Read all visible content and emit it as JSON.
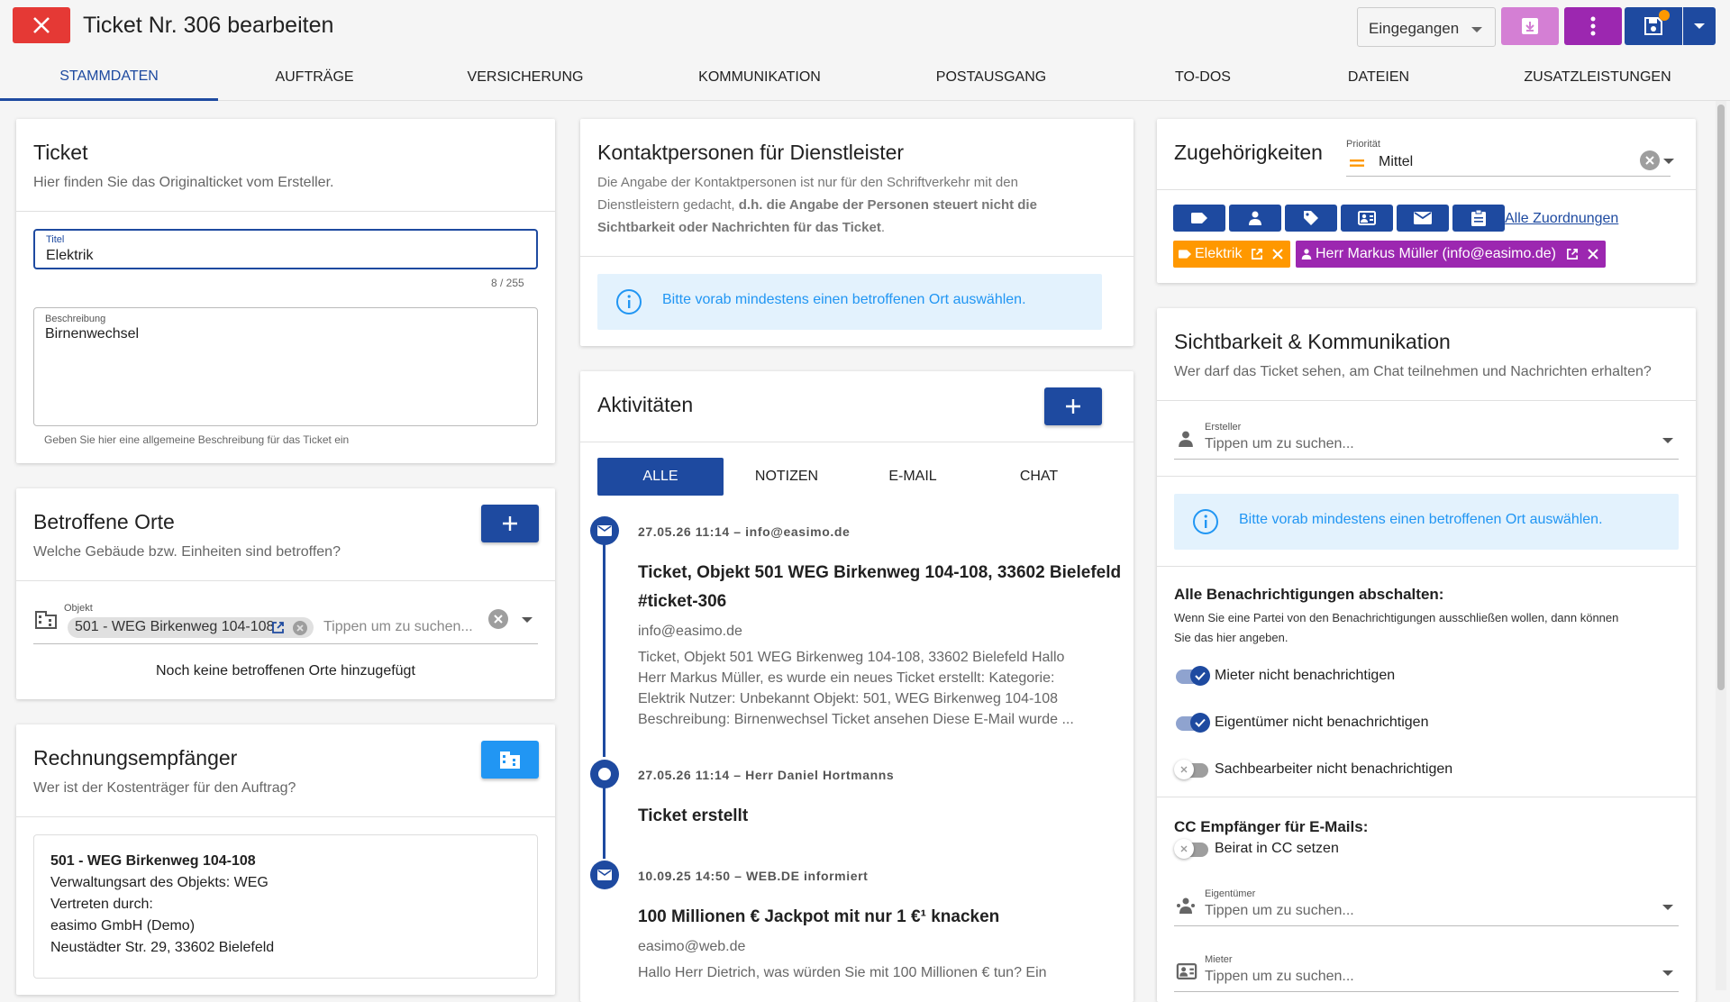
{
  "header": {
    "title": "Ticket Nr. 306 bearbeiten",
    "status_value": "Eingegangen",
    "colors": {
      "close": "#e53935",
      "download": "#d47fd4",
      "menu": "#9c27b0",
      "save": "#1e4aa0"
    }
  },
  "tabs": [
    {
      "label": "STAMMDATEN",
      "active": true
    },
    {
      "label": "AUFTRÄGE"
    },
    {
      "label": "VERSICHERUNG"
    },
    {
      "label": "KOMMUNIKATION"
    },
    {
      "label": "POSTAUSGANG"
    },
    {
      "label": "TO-DOS"
    },
    {
      "label": "DATEIEN"
    },
    {
      "label": "ZUSATZLEISTUNGEN"
    }
  ],
  "ticket": {
    "title": "Ticket",
    "subtitle": "Hier finden Sie das Originalticket vom Ersteller.",
    "titel_label": "Titel",
    "titel_value": "Elektrik",
    "counter": "8 / 255",
    "beschreibung_label": "Beschreibung",
    "beschreibung_value": "Birnenwechsel",
    "beschreibung_hint": "Geben Sie hier eine allgemeine Beschreibung für das Ticket ein"
  },
  "orte": {
    "title": "Betroffene Orte",
    "subtitle": "Welche Gebäude bzw. Einheiten sind betroffen?",
    "objekt_label": "Objekt",
    "objekt_chip": "501 - WEG Birkenweg 104-108",
    "placeholder": "Tippen um zu suchen...",
    "empty_text": "Noch keine betroffenen Orte hinzugefügt"
  },
  "rechnung": {
    "title": "Rechnungsempfänger",
    "subtitle": "Wer ist der Kostenträger für den Auftrag?",
    "lines": [
      "501 - WEG Birkenweg 104-108",
      "Verwaltungsart des Objekts: WEG",
      "Vertreten durch:",
      "easimo GmbH (Demo)",
      "Neustädter Str. 29, 33602 Bielefeld"
    ]
  },
  "kontakt": {
    "title": "Kontaktpersonen für Dienstleister",
    "desc_1": "Die Angabe der Kontaktpersonen ist nur für den Schriftverkehr mit den",
    "desc_2a": "Dienstleistern gedacht, ",
    "desc_2b": "d.h. die Angabe der Personen steuert nicht die",
    "desc_3b": "Sichtbarkeit oder Nachrichten für das Ticket",
    "desc_3c": ".",
    "info": "Bitte vorab mindestens einen betroffenen Ort auswählen."
  },
  "aktivitaeten": {
    "title": "Aktivitäten",
    "filters": [
      {
        "label": "ALLE",
        "active": true
      },
      {
        "label": "NOTIZEN"
      },
      {
        "label": "E-MAIL"
      },
      {
        "label": "CHAT"
      }
    ],
    "items": [
      {
        "meta": "27.05.26 11:14 – info@easimo.de",
        "title_1": "Ticket, Objekt 501 WEG Birkenweg 104-108, 33602 Bielefeld",
        "title_2": "#ticket-306",
        "from": "info@easimo.de",
        "body": [
          "Ticket, Objekt 501 WEG Birkenweg 104-108, 33602 Bielefeld Hallo",
          "Herr Markus Müller, es wurde ein neues Ticket erstellt: Kategorie:",
          "Elektrik Nutzer: Unbekannt Objekt: 501, WEG Birkenweg 104-108",
          "Beschreibung: Birnenwechsel Ticket ansehen Diese E-Mail wurde ..."
        ]
      },
      {
        "meta": "27.05.26 11:14 – Herr Daniel Hortmanns",
        "title_1": "Ticket erstellt"
      },
      {
        "meta": "10.09.25 14:50 – WEB.DE informiert",
        "title_1": "100 Millionen € Jackpot mit nur 1 €¹ knacken",
        "from": "easimo@web.de",
        "body": [
          "Hallo Herr Dietrich, was würden Sie mit 100 Millionen € tun? Ein"
        ]
      }
    ]
  },
  "zugehoerigkeiten": {
    "title": "Zugehörigkeiten",
    "prio_label": "Priorität",
    "prio_value": "Mittel",
    "alle_link": "Alle Zuordnungen",
    "tags": [
      {
        "label": "Elektrik",
        "color": "#ff9800"
      },
      {
        "label": "Herr Markus Müller (info@easimo.de)",
        "color": "#9c27b0"
      }
    ]
  },
  "sichtbarkeit": {
    "title": "Sichtbarkeit & Kommunikation",
    "subtitle": "Wer darf das Ticket sehen, am Chat teilnehmen und Nachrichten erhalten?",
    "ersteller_label": "Ersteller",
    "placeholder": "Tippen um zu suchen...",
    "info": "Bitte vorab mindestens einen betroffenen Ort auswählen.",
    "notify_title": "Alle Benachrichtigungen abschalten:",
    "notify_desc_1": "Wenn Sie eine Partei von den Benachrichtigungen ausschließen wollen, dann können",
    "notify_desc_2": "Sie das hier angeben.",
    "toggles": [
      {
        "label": "Mieter nicht benachrichtigen",
        "on": true
      },
      {
        "label": "Eigentümer nicht benachrichtigen",
        "on": true
      },
      {
        "label": "Sachbearbeiter nicht benachrichtigen",
        "on": false
      }
    ],
    "cc_title": "CC Empfänger für E-Mails:",
    "cc_toggle": {
      "label": "Beirat in CC setzen",
      "on": false
    },
    "eigentuemer_label": "Eigentümer",
    "mieter_label": "Mieter"
  }
}
